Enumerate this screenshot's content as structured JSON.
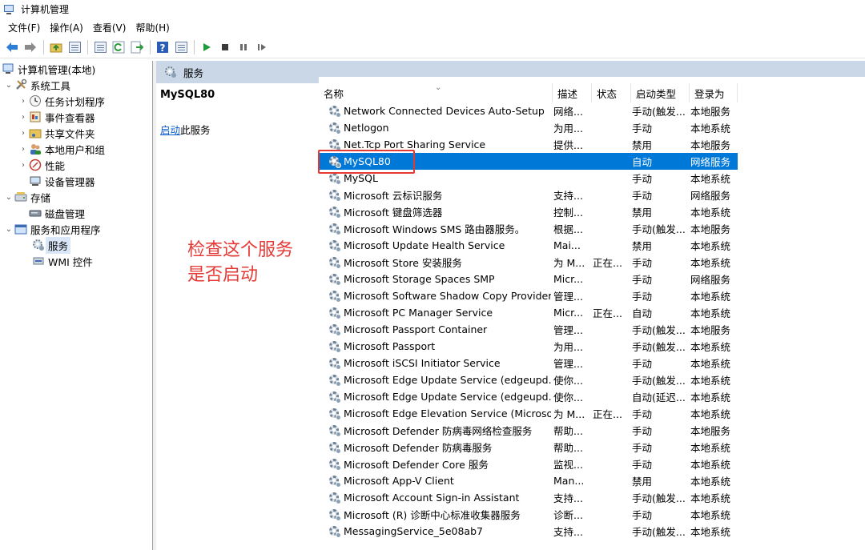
{
  "window": {
    "title": "计算机管理"
  },
  "menu": [
    "文件(F)",
    "操作(A)",
    "查看(V)",
    "帮助(H)"
  ],
  "toolbar": {
    "icons": [
      "back-arrow-icon",
      "forward-arrow-icon",
      "up-folder-icon",
      "show-hide-tree-icon",
      "properties-icon",
      "refresh-icon",
      "export-list-icon",
      "help-icon",
      "show-hide-action-pane-icon",
      "play-icon",
      "stop-icon",
      "pause-icon",
      "restart-icon"
    ]
  },
  "tree": {
    "root": "计算机管理(本地)",
    "system_tools": "系统工具",
    "task_scheduler": "任务计划程序",
    "event_viewer": "事件查看器",
    "shared_folders": "共享文件夹",
    "local_users": "本地用户和组",
    "performance": "性能",
    "device_manager": "设备管理器",
    "storage": "存储",
    "disk_management": "磁盘管理",
    "services_apps": "服务和应用程序",
    "services": "服务",
    "wmi": "WMI 控件"
  },
  "header": {
    "title": "服务"
  },
  "details": {
    "service_name": "MySQL80",
    "action_link": "启动",
    "action_suffix": "此服务"
  },
  "annotation": {
    "line1": "检查这个服务",
    "line2": "是否启动"
  },
  "columns": {
    "name": "名称",
    "desc": "描述",
    "status": "状态",
    "startup": "启动类型",
    "logon": "登录为"
  },
  "services": [
    {
      "name": "Network Connected Devices Auto-Setup",
      "desc": "网络...",
      "status": "",
      "startup": "手动(触发...",
      "logon": "本地服务"
    },
    {
      "name": "Netlogon",
      "desc": "为用...",
      "status": "",
      "startup": "手动",
      "logon": "本地系统"
    },
    {
      "name": "Net.Tcp Port Sharing Service",
      "desc": "提供...",
      "status": "",
      "startup": "禁用",
      "logon": "本地服务"
    },
    {
      "name": "MySQL80",
      "desc": "",
      "status": "",
      "startup": "自动",
      "logon": "网络服务"
    },
    {
      "name": "MySQL",
      "desc": "",
      "status": "",
      "startup": "手动",
      "logon": "本地系统"
    },
    {
      "name": "Microsoft 云标识服务",
      "desc": "支持...",
      "status": "",
      "startup": "手动",
      "logon": "网络服务"
    },
    {
      "name": "Microsoft 键盘筛选器",
      "desc": "控制...",
      "status": "",
      "startup": "禁用",
      "logon": "本地系统"
    },
    {
      "name": "Microsoft Windows SMS 路由器服务。",
      "desc": "根据...",
      "status": "",
      "startup": "手动(触发...",
      "logon": "本地服务"
    },
    {
      "name": "Microsoft Update Health Service",
      "desc": "Mai...",
      "status": "",
      "startup": "禁用",
      "logon": "本地系统"
    },
    {
      "name": "Microsoft Store 安装服务",
      "desc": "为 M...",
      "status": "正在...",
      "startup": "手动",
      "logon": "本地系统"
    },
    {
      "name": "Microsoft Storage Spaces SMP",
      "desc": "Micr...",
      "status": "",
      "startup": "手动",
      "logon": "网络服务"
    },
    {
      "name": "Microsoft Software Shadow Copy Provider",
      "desc": "管理...",
      "status": "",
      "startup": "手动",
      "logon": "本地系统"
    },
    {
      "name": "Microsoft PC Manager Service",
      "desc": "Micr...",
      "status": "正在...",
      "startup": "自动",
      "logon": "本地系统"
    },
    {
      "name": "Microsoft Passport Container",
      "desc": "管理...",
      "status": "",
      "startup": "手动(触发...",
      "logon": "本地服务"
    },
    {
      "name": "Microsoft Passport",
      "desc": "为用...",
      "status": "",
      "startup": "手动(触发...",
      "logon": "本地系统"
    },
    {
      "name": "Microsoft iSCSI Initiator Service",
      "desc": "管理...",
      "status": "",
      "startup": "手动",
      "logon": "本地系统"
    },
    {
      "name": "Microsoft Edge Update Service (edgeupd...",
      "desc": "使你...",
      "status": "",
      "startup": "手动(触发...",
      "logon": "本地系统"
    },
    {
      "name": "Microsoft Edge Update Service (edgeupd...",
      "desc": "使你...",
      "status": "",
      "startup": "自动(延迟...",
      "logon": "本地系统"
    },
    {
      "name": "Microsoft Edge Elevation Service (Microso...",
      "desc": "为 M...",
      "status": "正在...",
      "startup": "手动",
      "logon": "本地系统"
    },
    {
      "name": "Microsoft Defender 防病毒网络检查服务",
      "desc": "帮助...",
      "status": "",
      "startup": "手动",
      "logon": "本地服务"
    },
    {
      "name": "Microsoft Defender 防病毒服务",
      "desc": "帮助...",
      "status": "",
      "startup": "手动",
      "logon": "本地系统"
    },
    {
      "name": "Microsoft Defender Core 服务",
      "desc": "监视...",
      "status": "",
      "startup": "手动",
      "logon": "本地系统"
    },
    {
      "name": "Microsoft App-V Client",
      "desc": "Man...",
      "status": "",
      "startup": "禁用",
      "logon": "本地系统"
    },
    {
      "name": "Microsoft Account Sign-in Assistant",
      "desc": "支持...",
      "status": "",
      "startup": "手动(触发...",
      "logon": "本地系统"
    },
    {
      "name": "Microsoft (R) 诊断中心标准收集器服务",
      "desc": "诊断...",
      "status": "",
      "startup": "手动",
      "logon": "本地系统"
    },
    {
      "name": "MessagingService_5e08ab7",
      "desc": "支持...",
      "status": "",
      "startup": "手动(触发...",
      "logon": "本地系统"
    }
  ],
  "selected_service": "MySQL80",
  "colors": {
    "selection": "#0078d7",
    "annotation": "#e53935",
    "header_band": "#cad7e6"
  }
}
